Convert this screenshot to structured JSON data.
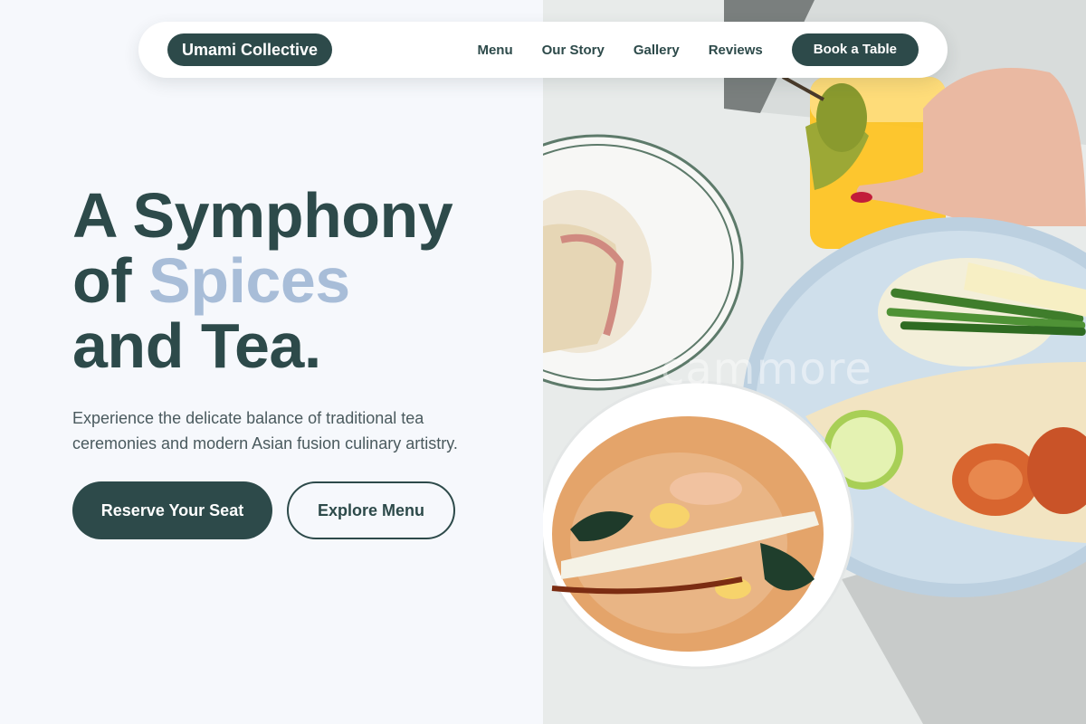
{
  "nav": {
    "brand": "Umami Collective",
    "links": [
      "Menu",
      "Our Story",
      "Gallery",
      "Reviews"
    ],
    "cta": "Book a Table"
  },
  "hero": {
    "headline_line1": "A Symphony",
    "headline_of": "of",
    "headline_accent": "Spices",
    "headline_line3": "and Tea.",
    "subtitle": "Experience the delicate balance of traditional tea ceremonies and modern Asian fusion culinary artistry.",
    "primary_button": "Reserve Your Seat",
    "secondary_button": "Explore Menu"
  },
  "image": {
    "watermark": "cammore",
    "description": "food-photo"
  },
  "colors": {
    "brand": "#2d4a4a",
    "accent": "#a8bdd8",
    "background": "#f6f8fc"
  }
}
